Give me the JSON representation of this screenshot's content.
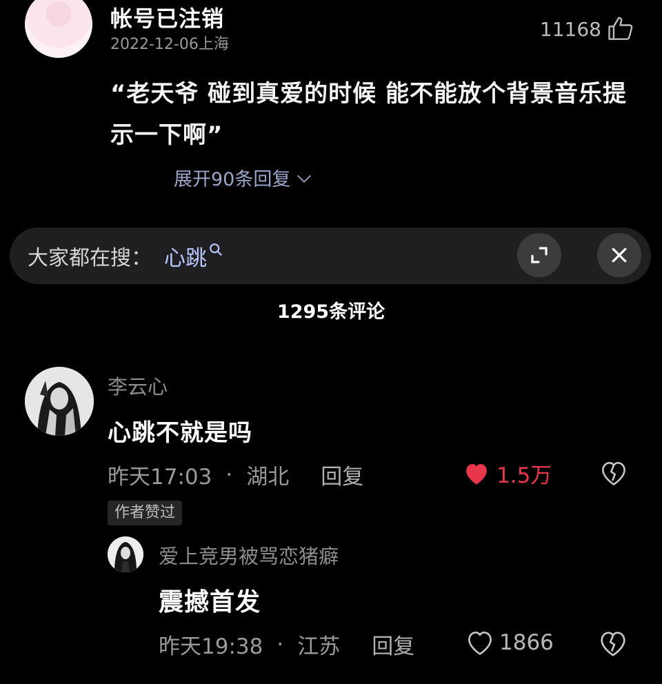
{
  "top_comment": {
    "username": "帐号已注销",
    "date": "2022-12-06",
    "location": "上海",
    "like_count": "11168",
    "text": "“老天爷 碰到真爱的时候 能不能放个背景音乐提示一下啊”",
    "expand_label": "展开90条回复"
  },
  "search_bar": {
    "prefix": "大家都在搜：",
    "term": "心跳"
  },
  "comment_count": "1295条评论",
  "comments": [
    {
      "username": "李云心",
      "text": "心跳不就是吗",
      "time": "昨天17:03",
      "location": "湖北",
      "reply_label": "回复",
      "likes": "1.5万",
      "liked": true,
      "badge": "作者赞过",
      "replies": [
        {
          "username": "爱上竞男被骂恋猪癖",
          "text": "震撼首发",
          "time": "昨天19:38",
          "location": "江苏",
          "reply_label": "回复",
          "likes": "1866",
          "liked": false
        }
      ]
    }
  ],
  "colors": {
    "background": "#000000",
    "liked_heart": "#e8374b",
    "search_term": "#b9c8ff",
    "expand_link": "#9aa6c8"
  },
  "icons": {
    "thumb": "thumbs-up-icon",
    "heart": "heart-icon",
    "broken_heart": "broken-heart-icon",
    "search": "search-icon",
    "expand": "expand-icon",
    "close": "close-icon",
    "chevron": "chevron-down-icon"
  }
}
